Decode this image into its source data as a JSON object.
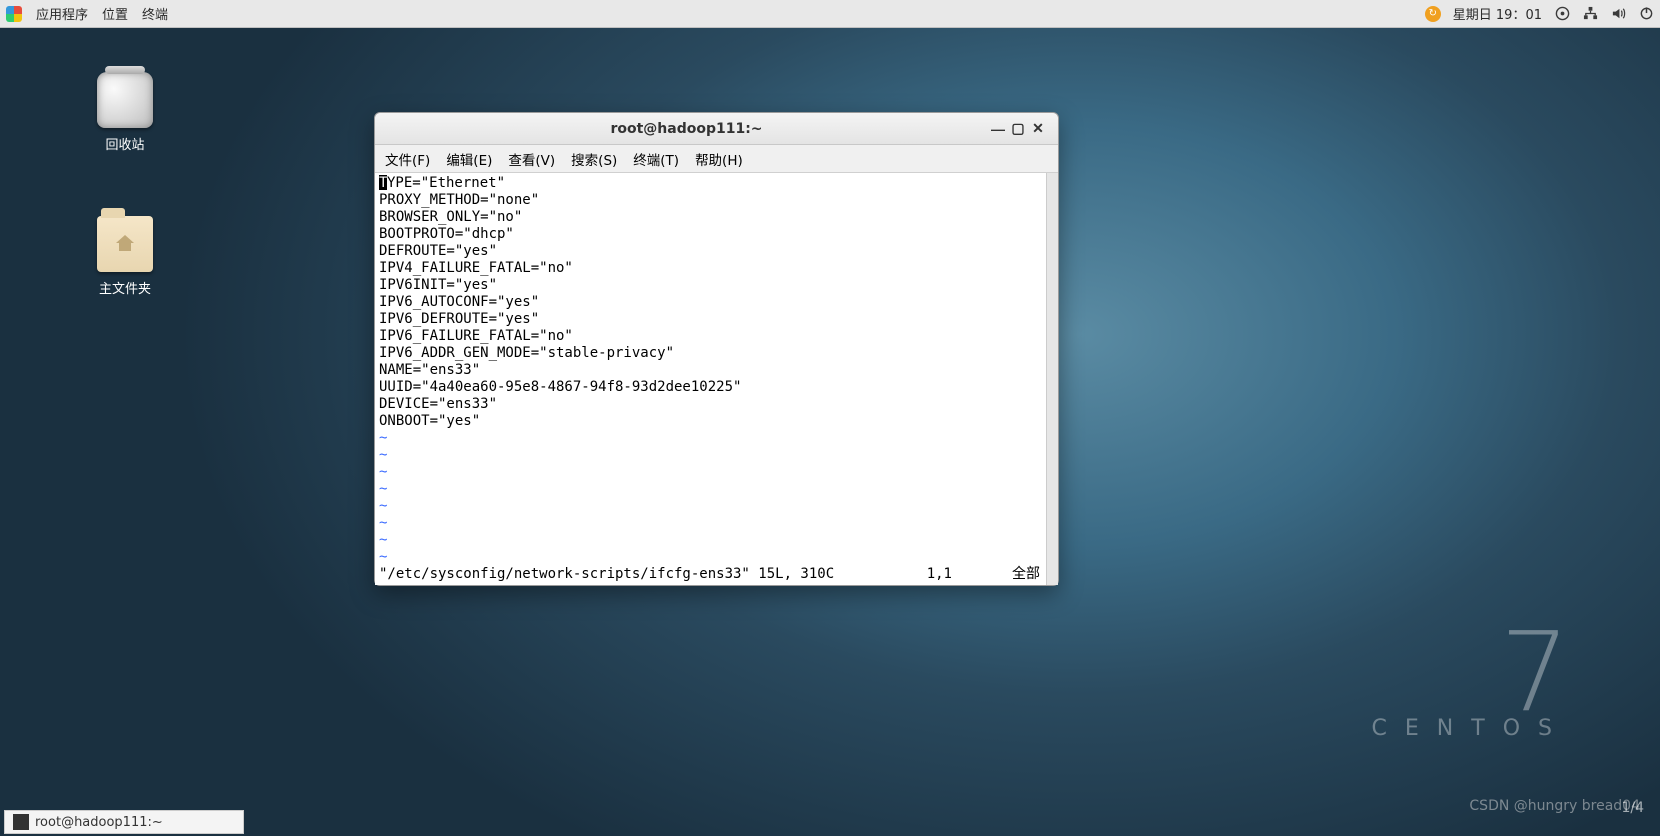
{
  "top_panel": {
    "menus": {
      "apps": "应用程序",
      "places": "位置",
      "terminal": "终端"
    },
    "clock": "星期日 19：01"
  },
  "desktop": {
    "trash": "回收站",
    "home": "主文件夹",
    "centos_seven": "7",
    "centos_name": "CENTOS",
    "watermark": "CSDN @hungry bread04",
    "pagenum": "1/4"
  },
  "terminal": {
    "title": "root@hadoop111:~",
    "menus": {
      "file": "文件(F)",
      "edit": "编辑(E)",
      "view": "查看(V)",
      "search": "搜索(S)",
      "terminal": "终端(T)",
      "help": "帮助(H)"
    },
    "lines": [
      "TYPE=\"Ethernet\"",
      "PROXY_METHOD=\"none\"",
      "BROWSER_ONLY=\"no\"",
      "BOOTPROTO=\"dhcp\"",
      "DEFROUTE=\"yes\"",
      "IPV4_FAILURE_FATAL=\"no\"",
      "IPV6INIT=\"yes\"",
      "IPV6_AUTOCONF=\"yes\"",
      "IPV6_DEFROUTE=\"yes\"",
      "IPV6_FAILURE_FATAL=\"no\"",
      "IPV6_ADDR_GEN_MODE=\"stable-privacy\"",
      "NAME=\"ens33\"",
      "UUID=\"4a40ea60-95e8-4867-94f8-93d2dee10225\"",
      "DEVICE=\"ens33\"",
      "ONBOOT=\"yes\""
    ],
    "tilde": "~",
    "status": {
      "file": "\"/etc/sysconfig/network-scripts/ifcfg-ens33\" 15L, 310C",
      "pos": "1,1",
      "pct": "全部"
    }
  },
  "taskbar": {
    "task1": "root@hadoop111:~"
  }
}
